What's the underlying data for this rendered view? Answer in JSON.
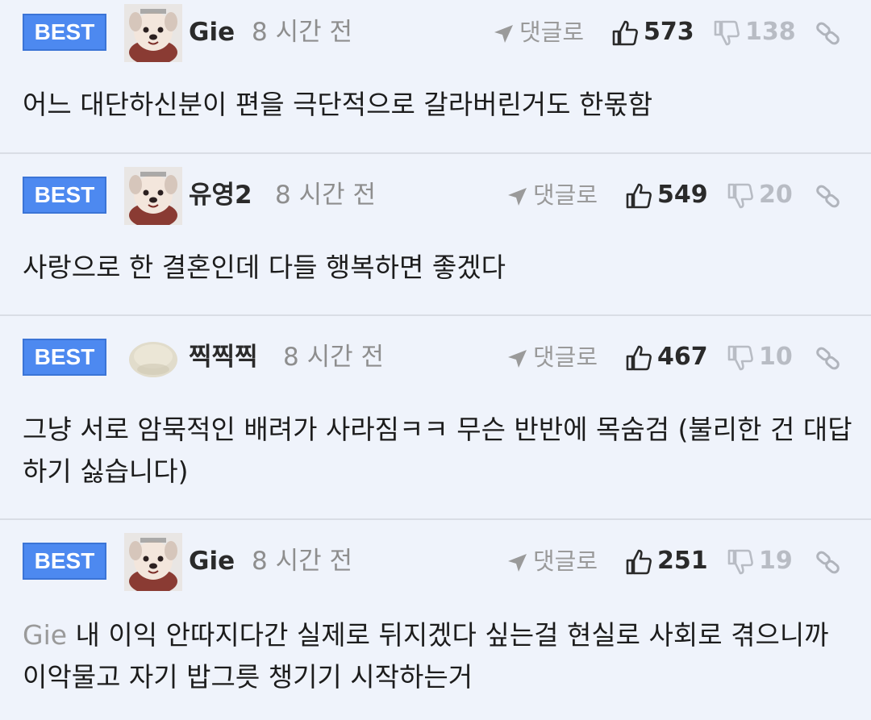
{
  "colors": {
    "background": "#eff3fb",
    "badge": "#4d89f0",
    "divider": "#d9dde5",
    "muted_text": "#8e8e8e"
  },
  "comments": [
    {
      "badge": "BEST",
      "avatar": "puppy-avatar",
      "nickname": "Gie",
      "time": "8 시간 전",
      "reply_label": "댓글로",
      "likes": "573",
      "dislikes": "138",
      "mention": "",
      "text": "어느 대단하신분이 편을 극단적으로 갈라버린거도 한몫함"
    },
    {
      "badge": "BEST",
      "avatar": "puppy-avatar",
      "nickname": "유영2",
      "time": "8 시간 전",
      "reply_label": "댓글로",
      "likes": "549",
      "dislikes": "20",
      "mention": "",
      "text": "사랑으로 한 결혼인데 다들 행복하면 좋겠다"
    },
    {
      "badge": "BEST",
      "avatar": "round-blob-avatar",
      "nickname": "찍찍찍",
      "time": "8 시간 전",
      "reply_label": "댓글로",
      "likes": "467",
      "dislikes": "10",
      "mention": "",
      "text": "그냥 서로 암묵적인 배려가 사라짐ㅋㅋ 무슨 반반에 목숨검 (불리한 건 대답하기 싫습니다)"
    },
    {
      "badge": "BEST",
      "avatar": "puppy-avatar",
      "nickname": "Gie",
      "time": "8 시간 전",
      "reply_label": "댓글로",
      "likes": "251",
      "dislikes": "19",
      "mention": "Gie",
      "text": "내 이익 안따지다간 실제로 뒤지겠다 싶는걸 현실로 사회로 겪으니까 이악물고 자기 밥그릇 챙기기 시작하는거"
    }
  ]
}
